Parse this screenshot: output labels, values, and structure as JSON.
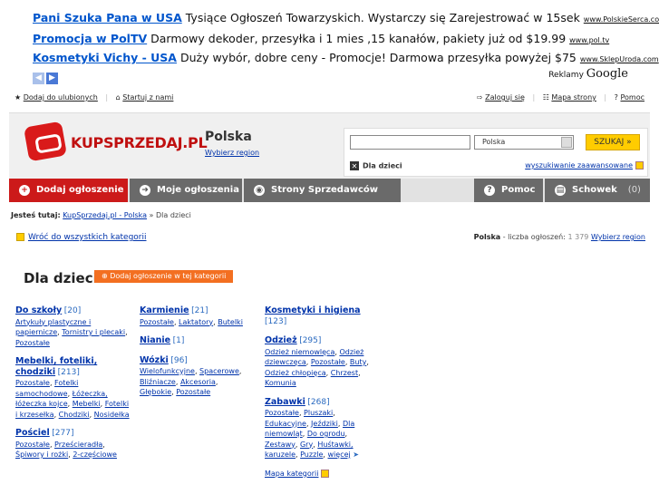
{
  "ads": [
    {
      "title": "Pani Szuka Pana w USA",
      "text": "Tysiące Ogłoszeń Towarzyskich. Wystarczy się Zarejestrować w 15sek",
      "url": "www.PolskieSerca.com"
    },
    {
      "title": "Promocja w PolTV",
      "text": "Darmowy dekoder, przesyłka i 1 mies ,15 kanałów, pakiety już od $19.99",
      "url": "www.pol.tv"
    },
    {
      "title": "Kosmetyki Vichy - USA",
      "text": "Duży wybór, dobre ceny - Promocje! Darmowa przesyłka powyżej $75",
      "url": "www.SklepUroda.com"
    }
  ],
  "ad_footer": {
    "label": "Reklamy",
    "brand": "Google"
  },
  "toplinks": {
    "favorites": "Dodaj do ulubionych",
    "homepage": "Startuj z nami",
    "login": "Zaloguj się",
    "sitemap": "Mapa strony",
    "help": "Pomoc"
  },
  "logo": {
    "kup": "KUP",
    "sprzedaj": "SPRZEDAJ.PL"
  },
  "region": {
    "name": "Polska",
    "choose": "Wybierz region"
  },
  "search": {
    "query": "",
    "select_value": "Polska",
    "button": "SZUKAJ »",
    "kids_filter": "Dla dzieci",
    "advanced": "wyszukiwanie zaawansowane"
  },
  "nav": {
    "add": "Dodaj ogłoszenie",
    "mine": "Moje ogłoszenia",
    "sellers": "Strony Sprzedawców",
    "help": "Pomoc",
    "clipboard": "Schowek",
    "clipboard_count": "(0)"
  },
  "breadcrumb": {
    "label": "Jesteś tutaj:",
    "home": "KupSprzedaj.pl - Polska",
    "sep": " » ",
    "current": "Dla dzieci"
  },
  "back_link": "Wróć do wszystkich kategorii",
  "count": {
    "region": "Polska",
    "label": " - liczba ogłoszeń: ",
    "value": "1 379",
    "choose": "Wybierz region"
  },
  "page_title": "Dla dzieci",
  "add_in_category": "Dodaj ogłoszenie w tej kategorii",
  "columns": [
    [
      {
        "name": "Do szkoły",
        "count": "[20]",
        "subs": [
          "Artykuły plastyczne i papiernicze",
          "Tornistry i plecaki",
          "Pozostałe"
        ]
      },
      {
        "name": "Mebelki, foteliki, chodziki",
        "count": "[213]",
        "subs": [
          "Pozostałe",
          "Fotelki samochodowe",
          "Łóżeczka, łóżeczka kojce",
          "Mebelki",
          "Fotelki i krzesełka",
          "Chodziki",
          "Nosidełka"
        ]
      },
      {
        "name": "Pościel",
        "count": "[277]",
        "subs": [
          "Pozostałe",
          "Prześcieradła",
          "Śpiwory i rożki",
          "2-częściowe"
        ]
      }
    ],
    [
      {
        "name": "Karmienie",
        "count": "[21]",
        "subs": [
          "Pozostałe",
          "Laktatory",
          "Butelki"
        ]
      },
      {
        "name": "Nianie",
        "count": "[1]",
        "subs": []
      },
      {
        "name": "Wózki",
        "count": "[96]",
        "subs": [
          "Wielofunkcyjne",
          "Spacerowe",
          "Bliźniacze",
          "Akcesoria",
          "Głębokie",
          "Pozostałe"
        ]
      }
    ],
    [
      {
        "name": "Kosmetyki i higiena",
        "count": "[123]",
        "subs": []
      },
      {
        "name": "Odzież",
        "count": "[295]",
        "subs": [
          "Odzież niemowlęca",
          "Odzież dziewczęca",
          "Pozostałe",
          "Buty",
          "Odzież chłopięca",
          "Chrzest",
          "Komunia"
        ]
      },
      {
        "name": "Zabawki",
        "count": "[268]",
        "subs": [
          "Pozostałe",
          "Pluszaki",
          "Edukacyjne",
          "Jeździki",
          "Dla niemowląt",
          "Do ogrodu",
          "Zestawy",
          "Gry",
          "Huśtawki, karuzele",
          "Puzzle",
          "więcej"
        ]
      }
    ]
  ],
  "category_map": "Mapa kategorii"
}
